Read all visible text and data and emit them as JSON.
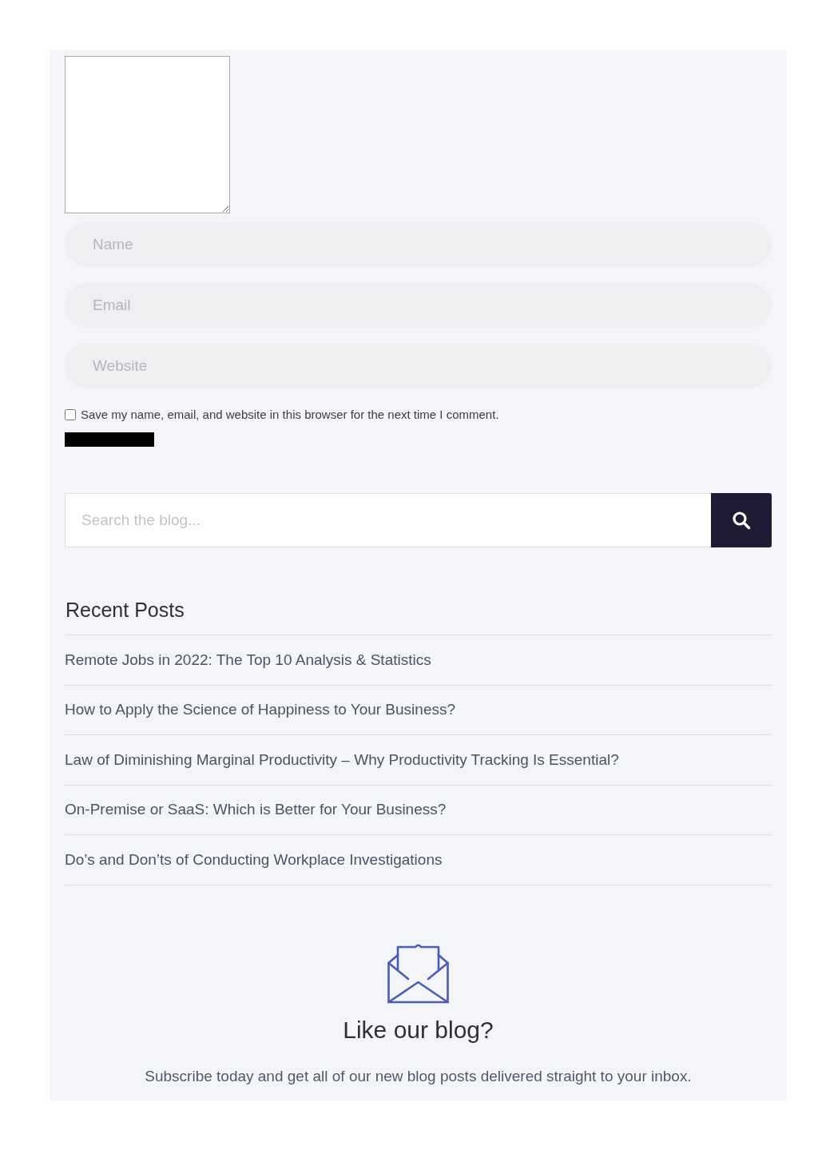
{
  "comment_form": {
    "fields": [
      {
        "placeholder": "Name"
      },
      {
        "placeholder": "Email"
      },
      {
        "placeholder": "Website"
      }
    ],
    "save_info": {
      "label": "Save my name, email, and website in this browser for the next time I comment.",
      "checked": false
    }
  },
  "search": {
    "placeholder": "Search the blog..."
  },
  "recent_posts": {
    "title": "Recent Posts",
    "items": [
      "Remote Jobs in 2022: The Top 10 Analysis & Statistics",
      "How to Apply the Science of Happiness to Your Business?",
      "Law of Diminishing Marginal Productivity – Why Productivity Tracking Is Essential?",
      "On-Premise or SaaS: Which is Better for Your Business?",
      "Do’s and Don’ts of Conducting Workplace Investigations"
    ]
  },
  "subscribe": {
    "title": "Like our blog?",
    "text": "Subscribe today and get all of our new blog posts delivered straight to your inbox."
  }
}
